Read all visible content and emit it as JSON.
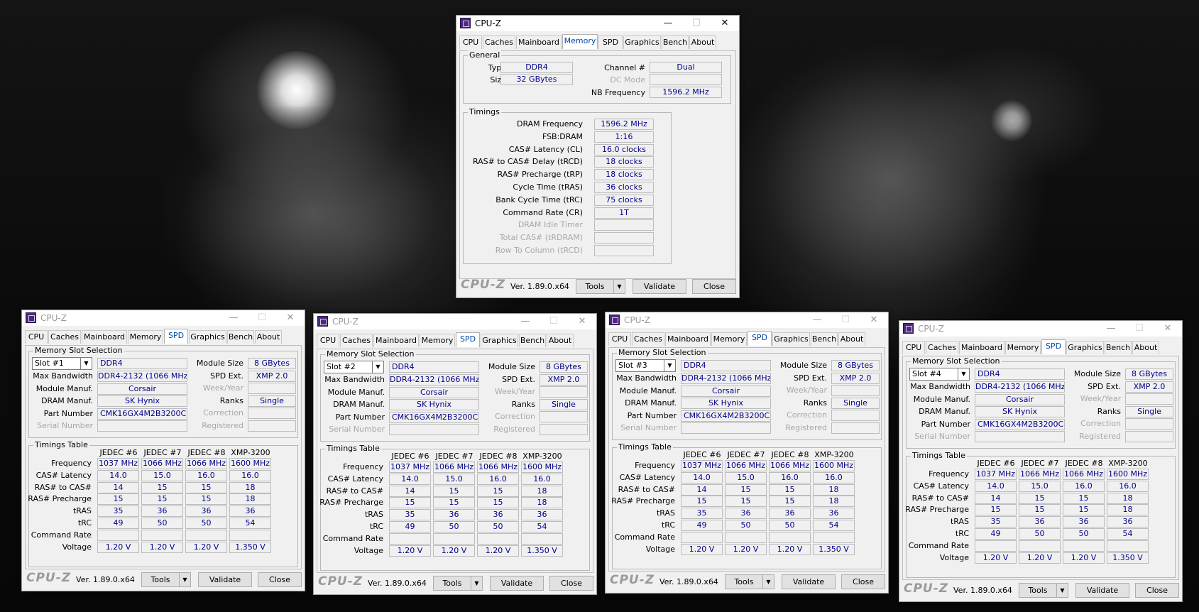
{
  "window_title": "CPU-Z",
  "tabs": [
    "CPU",
    "Caches",
    "Mainboard",
    "Memory",
    "SPD",
    "Graphics",
    "Bench",
    "About"
  ],
  "version": "Ver. 1.89.0.x64",
  "logo": "CPU-Z",
  "tools_label": "Tools",
  "validate_label": "Validate",
  "close_label": "Close",
  "memory": {
    "general_label": "General",
    "type_label": "Type",
    "type": "DDR4",
    "size_label": "Size",
    "size": "32 GBytes",
    "channel_label": "Channel #",
    "channel": "Dual",
    "dcmode_label": "DC Mode",
    "dcmode": "",
    "nbfreq_label": "NB Frequency",
    "nbfreq": "1596.2 MHz",
    "timings_label": "Timings",
    "timings": [
      {
        "label": "DRAM Frequency",
        "value": "1596.2 MHz",
        "disabled": false
      },
      {
        "label": "FSB:DRAM",
        "value": "1:16",
        "disabled": false
      },
      {
        "label": "CAS# Latency (CL)",
        "value": "16.0 clocks",
        "disabled": false
      },
      {
        "label": "RAS# to CAS# Delay (tRCD)",
        "value": "18 clocks",
        "disabled": false
      },
      {
        "label": "RAS# Precharge (tRP)",
        "value": "18 clocks",
        "disabled": false
      },
      {
        "label": "Cycle Time (tRAS)",
        "value": "36 clocks",
        "disabled": false
      },
      {
        "label": "Bank Cycle Time (tRC)",
        "value": "75 clocks",
        "disabled": false
      },
      {
        "label": "Command Rate (CR)",
        "value": "1T",
        "disabled": false
      },
      {
        "label": "DRAM Idle Timer",
        "value": "",
        "disabled": true
      },
      {
        "label": "Total CAS# (tRDRAM)",
        "value": "",
        "disabled": true
      },
      {
        "label": "Row To Column (tRCD)",
        "value": "",
        "disabled": true
      }
    ]
  },
  "spd_labels": {
    "slot_selection": "Memory Slot Selection",
    "max_bandwidth": "Max Bandwidth",
    "module_manuf": "Module Manuf.",
    "dram_manuf": "DRAM Manuf.",
    "part_number": "Part Number",
    "serial_number": "Serial Number",
    "module_size": "Module Size",
    "spd_ext": "SPD Ext.",
    "week_year": "Week/Year",
    "ranks": "Ranks",
    "correction": "Correction",
    "registered": "Registered",
    "timings_table": "Timings Table",
    "columns": [
      "JEDEC #6",
      "JEDEC #7",
      "JEDEC #8",
      "XMP-3200"
    ],
    "rows": [
      "Frequency",
      "CAS# Latency",
      "RAS# to CAS#",
      "RAS# Precharge",
      "tRAS",
      "tRC",
      "Command Rate",
      "Voltage"
    ]
  },
  "spd_values": {
    "type": "DDR4",
    "max_bandwidth": "DDR4-2132 (1066 MHz)",
    "module_manuf": "Corsair",
    "dram_manuf": "SK Hynix",
    "part_number": "CMK16GX4M2B3200C16",
    "module_size": "8 GBytes",
    "spd_ext": "XMP 2.0",
    "ranks": "Single",
    "table": [
      [
        "1037 MHz",
        "1066 MHz",
        "1066 MHz",
        "1600 MHz"
      ],
      [
        "14.0",
        "15.0",
        "16.0",
        "16.0"
      ],
      [
        "14",
        "15",
        "15",
        "18"
      ],
      [
        "15",
        "15",
        "15",
        "18"
      ],
      [
        "35",
        "36",
        "36",
        "36"
      ],
      [
        "49",
        "50",
        "50",
        "54"
      ],
      [
        "",
        "",
        "",
        ""
      ],
      [
        "1.20 V",
        "1.20 V",
        "1.20 V",
        "1.350 V"
      ]
    ]
  },
  "slots": [
    "Slot #1",
    "Slot #2",
    "Slot #3",
    "Slot #4"
  ]
}
